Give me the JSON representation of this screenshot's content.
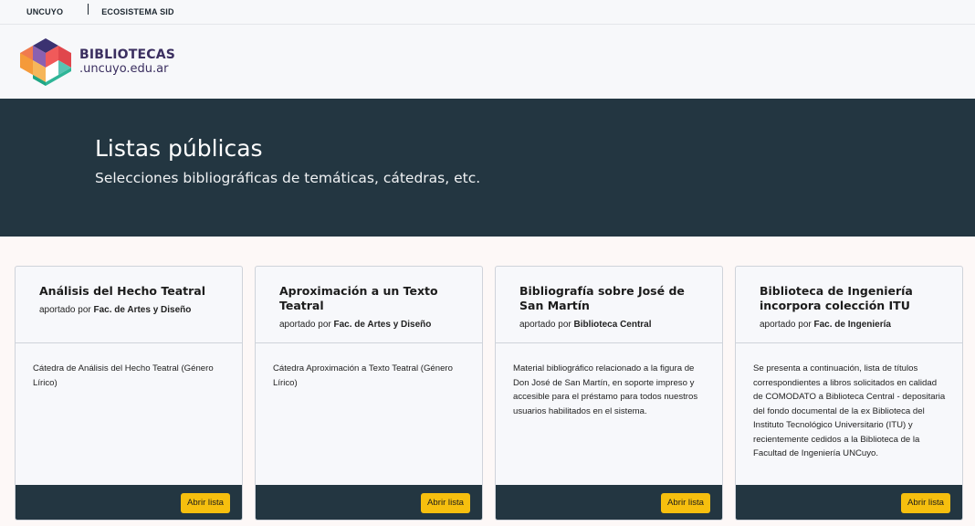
{
  "topbar": {
    "links": [
      "UNCUYO",
      "ECOSISTEMA SID"
    ]
  },
  "logo": {
    "line1": "BIBLIOTECAS",
    "line2": ".uncuyo.edu.ar"
  },
  "hero": {
    "title": "Listas públicas",
    "subtitle": "Selecciones bibliográficas de temáticas, cátedras, etc."
  },
  "cards": [
    {
      "title": "Análisis del Hecho Teatral",
      "by_prefix": "aportado por",
      "by": "Fac. de Artes y Diseño",
      "description": "Cátedra de Análisis del Hecho Teatral (Género Lírico)",
      "button": "Abrir lista"
    },
    {
      "title": "Aproximación a un Texto Teatral",
      "by_prefix": "aportado por",
      "by": "Fac. de Artes y Diseño",
      "description": "Cátedra Aproximación a Texto Teatral (Género Lírico)",
      "button": "Abrir lista"
    },
    {
      "title": "Bibliografía sobre José de San Martín",
      "by_prefix": "aportado por",
      "by": "Biblioteca Central",
      "description": "Material bibliográfico relacionado a la figura de Don José de San Martín, en soporte impreso y accesible para el préstamo para todos nuestros usuarios habilitados en el sistema.",
      "button": "Abrir lista"
    },
    {
      "title": "Biblioteca de Ingeniería incorpora colección ITU",
      "by_prefix": "aportado por",
      "by": "Fac. de Ingeniería",
      "description": "Se presenta a continuación, lista de títulos correspondientes a libros solicitados en calidad de COMODATO a Biblioteca Central - depositaria del fondo documental de la ex Biblioteca del Instituto Tecnológico Universitario (ITU) y recientemente cedidos a la Biblioteca de la Facultad de Ingeniería UNCuyo.",
      "button": "Abrir lista"
    }
  ]
}
